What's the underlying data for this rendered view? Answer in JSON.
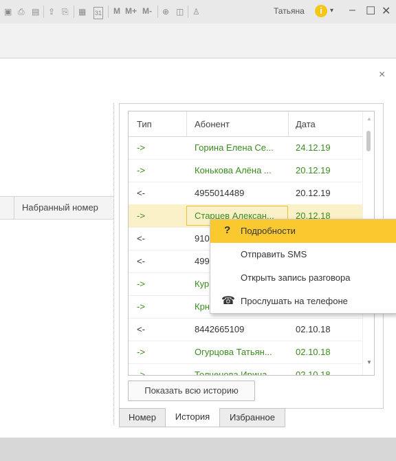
{
  "titlebar": {
    "user": "Татьяна",
    "m_buttons": [
      "M",
      "M+",
      "M-"
    ],
    "icons": [
      "save-icon",
      "print-icon",
      "preview-icon",
      "upload-icon",
      "print-preview-icon",
      "calculator-icon",
      "calendar-icon",
      "zoom-icon",
      "panel-icon",
      "user-icon",
      "info-icon",
      "minimize-icon",
      "maximize-icon",
      "close-icon"
    ],
    "calendar_day": "31"
  },
  "window": {
    "close_glyph": "×"
  },
  "left_pane": {
    "column_header": "Набранный номер"
  },
  "grid": {
    "columns": [
      "Тип",
      "Абонент",
      "Дата"
    ],
    "rows": [
      {
        "type": "->",
        "abonent": "Горина Елена Се...",
        "date": "24.12.19",
        "color": "#3a8b1e"
      },
      {
        "type": "->",
        "abonent": "Конькова Алёна ...",
        "date": "20.12.19",
        "color": "#3a8b1e"
      },
      {
        "type": "<-",
        "abonent": "4955014489",
        "date": "20.12.19",
        "color": "#333333"
      },
      {
        "type": "->",
        "abonent": "Старцев Алексан...",
        "date": "20.12.18",
        "color": "#3a8b1e"
      },
      {
        "type": "<-",
        "abonent": "910",
        "date": "",
        "color": "#333333"
      },
      {
        "type": "<-",
        "abonent": "499",
        "date": "",
        "color": "#333333"
      },
      {
        "type": "->",
        "abonent": "Кур",
        "date": "",
        "color": "#3a8b1e"
      },
      {
        "type": "->",
        "abonent": "Крн",
        "date": "",
        "color": "#3a8b1e"
      },
      {
        "type": "<-",
        "abonent": "8442665109",
        "date": "02.10.18",
        "color": "#333333"
      },
      {
        "type": "->",
        "abonent": "Огурцова Татьян...",
        "date": "02.10.18",
        "color": "#3a8b1e"
      },
      {
        "type": "->",
        "abonent": "Толченова Ирина...",
        "date": "02.10.18",
        "color": "#3a8b1e"
      }
    ]
  },
  "context_menu": {
    "items": [
      {
        "label": "Подробности",
        "icon": "?"
      },
      {
        "label": "Отправить SMS",
        "icon": ""
      },
      {
        "label": "Открыть запись разговора",
        "icon": ""
      },
      {
        "label": "Прослушать на телефоне",
        "icon": "☎"
      }
    ]
  },
  "buttons": {
    "show_history": "Показать всю историю"
  },
  "tabs": [
    "Номер",
    "История",
    "Избранное"
  ],
  "colors": {
    "accent": "#f9c92f",
    "green_text": "#3a8b1e",
    "selection_bg": "#fbf1c9"
  }
}
